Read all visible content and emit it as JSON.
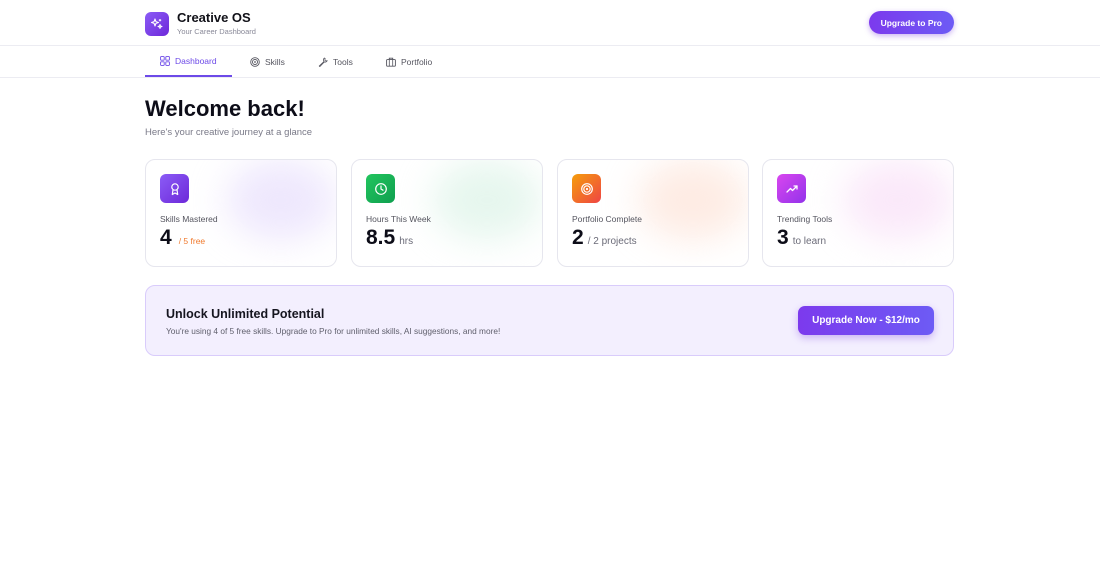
{
  "header": {
    "title": "Creative OS",
    "subtitle": "Your Career Dashboard",
    "upgrade_label": "Upgrade to Pro"
  },
  "tabs": [
    {
      "label": "Dashboard",
      "icon": "grid-icon",
      "active": true
    },
    {
      "label": "Skills",
      "icon": "target-icon",
      "active": false
    },
    {
      "label": "Tools",
      "icon": "wrench-icon",
      "active": false
    },
    {
      "label": "Portfolio",
      "icon": "briefcase-icon",
      "active": false
    }
  ],
  "main": {
    "title": "Welcome back!",
    "subtitle": "Here's your creative journey at a glance"
  },
  "stats": [
    {
      "label": "Skills Mastered",
      "value": "4",
      "unit": "/ 5 free",
      "icon": "award-icon",
      "color": "#7c3aed"
    },
    {
      "label": "Hours This Week",
      "value": "8.5",
      "unit": "hrs",
      "icon": "clock-icon",
      "color": "#16a34a"
    },
    {
      "label": "Portfolio Complete",
      "value": "2",
      "unit": "/ 2 projects",
      "icon": "target-icon",
      "color": "#f97316"
    },
    {
      "label": "Trending Tools",
      "value": "3",
      "unit": "to learn",
      "icon": "trending-up-icon",
      "color": "#c026d3"
    }
  ],
  "banner": {
    "title": "Unlock Unlimited Potential",
    "text": "You're using 4 of 5 free skills. Upgrade to Pro for unlimited skills, AI suggestions, and more!",
    "button_label": "Upgrade Now - $12/mo"
  },
  "colors": {
    "accent": "#6d4ae8",
    "banner_bg": "#f3effe"
  }
}
